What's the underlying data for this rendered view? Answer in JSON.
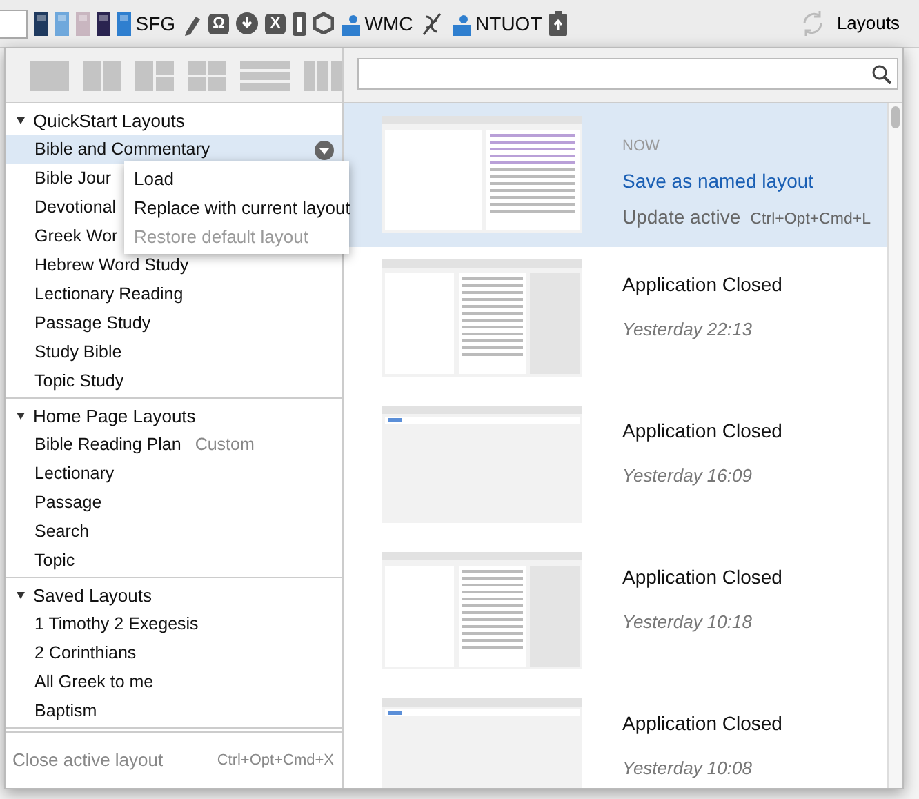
{
  "toolbar": {
    "items": [
      {
        "kind": "field"
      },
      {
        "kind": "book",
        "color": "#1f3a5f"
      },
      {
        "kind": "book",
        "color": "#6fa8dc"
      },
      {
        "kind": "book",
        "color": "#c9b6c0"
      },
      {
        "kind": "book",
        "color": "#2a2450"
      },
      {
        "kind": "book",
        "color": "#2f7fcf",
        "label": "SFG"
      },
      {
        "kind": "pen"
      },
      {
        "kind": "glyph",
        "glyph": "Ω"
      },
      {
        "kind": "download"
      },
      {
        "kind": "glyph",
        "glyph": "X"
      },
      {
        "kind": "bookmark"
      },
      {
        "kind": "hexagon"
      },
      {
        "kind": "person",
        "label": "WMC"
      },
      {
        "kind": "link"
      },
      {
        "kind": "person",
        "label": "NTUOT"
      },
      {
        "kind": "clipboard"
      }
    ],
    "layouts_button": {
      "label": "Layouts"
    }
  },
  "groups": [
    {
      "title": "QuickStart Layouts",
      "expanded": true,
      "items": [
        {
          "label": "Bible and Commentary",
          "selected": true
        },
        {
          "label": "Bible Jour",
          "selected": false
        },
        {
          "label": "Devotional",
          "selected": false
        },
        {
          "label": "Greek Wor",
          "selected": false
        },
        {
          "label": "Hebrew Word Study",
          "selected": false
        },
        {
          "label": "Lectionary Reading",
          "selected": false
        },
        {
          "label": "Passage Study",
          "selected": false
        },
        {
          "label": "Study Bible",
          "selected": false
        },
        {
          "label": "Topic Study",
          "selected": false
        }
      ]
    },
    {
      "title": "Home Page Layouts",
      "expanded": true,
      "items": [
        {
          "label": "Bible Reading Plan",
          "tag": "Custom",
          "selected": false
        },
        {
          "label": "Lectionary",
          "selected": false
        },
        {
          "label": "Passage",
          "selected": false
        },
        {
          "label": "Search",
          "selected": false
        },
        {
          "label": "Topic",
          "selected": false
        }
      ]
    },
    {
      "title": "Saved Layouts",
      "expanded": true,
      "items": [
        {
          "label": "1 Timothy 2 Exegesis",
          "selected": false
        },
        {
          "label": "2 Corinthians",
          "selected": false
        },
        {
          "label": "All Greek to me",
          "selected": false
        },
        {
          "label": "Baptism",
          "selected": false
        }
      ]
    }
  ],
  "context_menu": {
    "items": [
      {
        "label": "Load",
        "disabled": false
      },
      {
        "label": "Replace with current layout",
        "disabled": false
      },
      {
        "label": "Restore default layout",
        "disabled": true
      }
    ]
  },
  "footer": {
    "label": "Close active layout",
    "shortcut": "Ctrl+Opt+Cmd+X"
  },
  "history": [
    {
      "kind": "current",
      "selected": true,
      "when": "NOW",
      "save": "Save as named layout",
      "update": "Update active",
      "shortcut": "Ctrl+Opt+Cmd+L"
    },
    {
      "kind": "closed",
      "selected": false,
      "title": "Application Closed",
      "when": "Yesterday 22:13"
    },
    {
      "kind": "closed",
      "selected": false,
      "title": "Application Closed",
      "when": "Yesterday 16:09"
    },
    {
      "kind": "closed",
      "selected": false,
      "title": "Application Closed",
      "when": "Yesterday 10:18"
    },
    {
      "kind": "closed",
      "selected": false,
      "title": "Application Closed",
      "when": "Yesterday 10:08"
    }
  ]
}
